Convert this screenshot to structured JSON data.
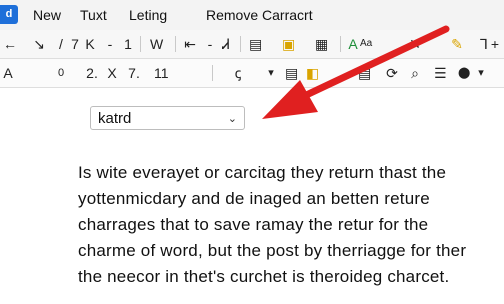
{
  "app_badge": "d",
  "menu": {
    "items": [
      "New",
      "Tuxt",
      "Leting",
      "Remove Carracrt"
    ]
  },
  "toolbar1": {
    "symbols": [
      "←",
      "↘",
      "/",
      "7",
      "K",
      "-",
      "1",
      "W",
      "⇤",
      "-",
      "Ꮧ",
      "▤",
      "▣",
      "▦",
      "A",
      "✕",
      "✎",
      "⅂"
    ],
    "style_label": "Aa",
    "add_label": "+"
  },
  "toolbar2": {
    "symbols": [
      "A",
      "0",
      "2.",
      "X",
      "7.",
      "11",
      "ꞔ",
      "▾",
      "▤",
      "◧",
      "▤",
      "⟳",
      "⌕",
      "☰",
      "⬤"
    ]
  },
  "style_dropdown": {
    "value": "katrd"
  },
  "document": {
    "lines": [
      "Is wite everayet or carcitag they return thast the",
      "yottenmicdary and de inaged an betten reture",
      "charrages that to save ramay the retur for the",
      "charme of word, but the post by therriagge for ther",
      "the neecor in thet's curchet is theroideg charcet."
    ]
  },
  "colors": {
    "accent": "#1e6fd9",
    "arrow": "#e02020"
  }
}
